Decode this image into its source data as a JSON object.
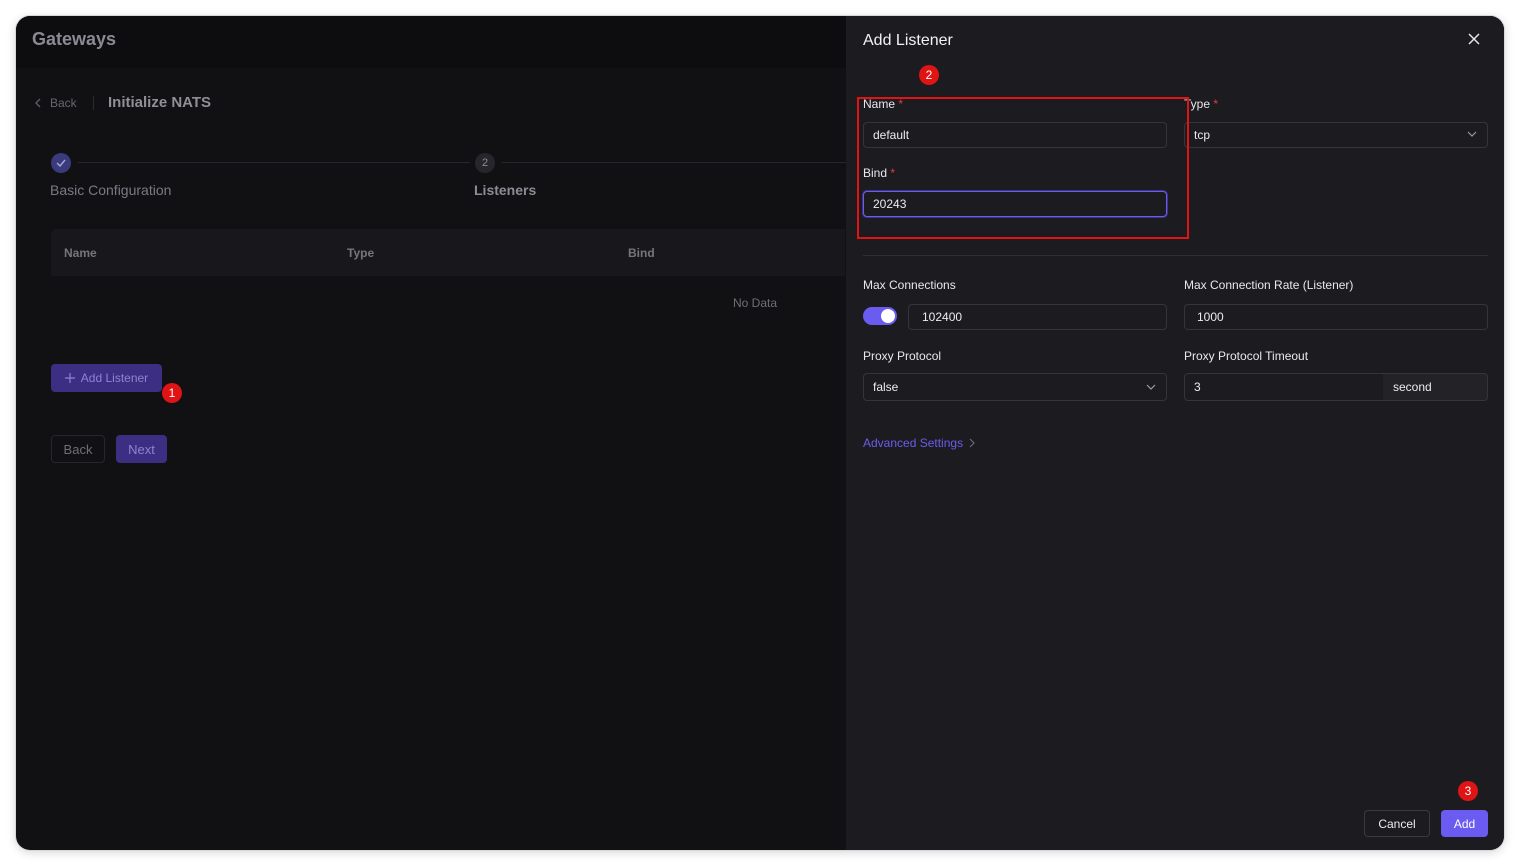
{
  "app": {
    "title": "Gateways"
  },
  "header": {
    "back_label": "Back",
    "page_title": "Initialize NATS"
  },
  "steps": [
    {
      "number": "",
      "label": "Basic Configuration",
      "status": "done"
    },
    {
      "number": "2",
      "label": "Listeners",
      "status": "active"
    }
  ],
  "table": {
    "columns": [
      "Name",
      "Type",
      "Bind"
    ],
    "empty_text": "No Data"
  },
  "actions": {
    "add_listener_label": "Add Listener",
    "back_label": "Back",
    "next_label": "Next"
  },
  "drawer": {
    "title": "Add Listener",
    "fields": {
      "name": {
        "label": "Name",
        "required": "*",
        "value": "default"
      },
      "type": {
        "label": "Type",
        "required": "*",
        "value": "tcp"
      },
      "bind": {
        "label": "Bind",
        "required": "*",
        "value": "20243"
      },
      "max_connections": {
        "label": "Max Connections",
        "value": "102400",
        "toggle_on": true
      },
      "max_connection_rate": {
        "label": "Max Connection Rate (Listener)",
        "value": "1000"
      },
      "proxy_protocol": {
        "label": "Proxy Protocol",
        "value": "false"
      },
      "proxy_protocol_timeout": {
        "label": "Proxy Protocol Timeout",
        "value": "3",
        "unit": "second"
      }
    },
    "advanced_label": "Advanced Settings",
    "cancel_label": "Cancel",
    "add_label": "Add"
  },
  "annotations": {
    "badge1": "1",
    "badge2": "2",
    "badge3": "3"
  },
  "colors": {
    "accent": "#6a5cf0",
    "annotation": "#e01414",
    "background": "#111114",
    "drawer": "#1c1c20"
  }
}
